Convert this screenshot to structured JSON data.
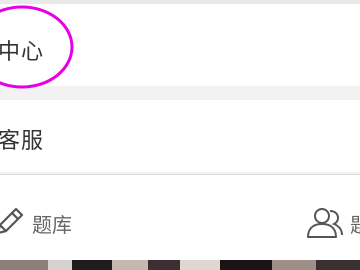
{
  "menu": {
    "items": [
      {
        "label": "中心",
        "highlighted": true,
        "highlight_color": "#e600e6"
      },
      {
        "label": "客服"
      }
    ]
  },
  "bottom_bar": {
    "items": [
      {
        "label": "题库",
        "icon": "pencil-icon"
      },
      {
        "label": "题",
        "icon": "users-icon"
      }
    ]
  },
  "colors": {
    "page_background": "#f2f2f2",
    "row_background": "#ffffff",
    "text": "#333333",
    "muted_text": "#666666",
    "annotation": "#e600e6"
  }
}
